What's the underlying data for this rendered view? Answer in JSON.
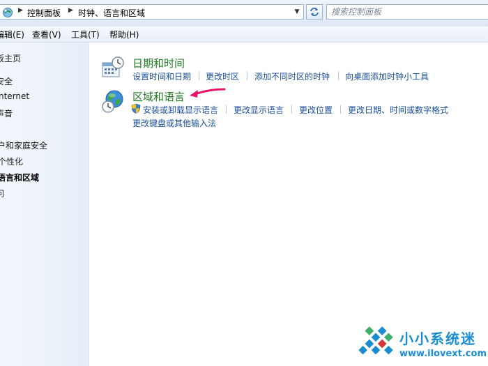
{
  "address_bar": {
    "breadcrumbs": [
      "控制面板",
      "时钟、语言和区域"
    ],
    "search_placeholder": "搜索控制面板"
  },
  "menu": {
    "items": [
      "编辑(E)",
      "查看(V)",
      "工具(T)",
      "帮助(H)"
    ]
  },
  "nav": {
    "items": [
      {
        "label": "板主页",
        "selected": false
      },
      {
        "label": "安全",
        "selected": false
      },
      {
        "label": "nternet",
        "selected": false
      },
      {
        "label": "声音",
        "selected": false
      },
      {
        "label": "户和家庭安全",
        "selected": false
      },
      {
        "label": "个性化",
        "selected": false
      },
      {
        "label": "语言和区域",
        "selected": true
      },
      {
        "label": "问",
        "selected": false
      }
    ]
  },
  "categories": [
    {
      "title": "日期和时间",
      "icon": "calendar-clock-icon",
      "tasks": [
        "设置时间和日期",
        "更改时区",
        "添加不同时区的时钟",
        "向桌面添加时钟小工具"
      ]
    },
    {
      "title": "区域和语言",
      "icon": "globe-clock-icon",
      "tasks": [
        "安装或卸载显示语言",
        "更改显示语言",
        "更改位置",
        "更改日期、时间或数字格式",
        "更改键盘或其他输入法"
      ],
      "first_task_icon": "uac-shield-icon"
    }
  ],
  "annotation": {
    "color": "#e8136b"
  },
  "watermark": {
    "title": "小小系统迷",
    "url": "www.ilovext.com"
  },
  "colors": {
    "category_title": "#1e7b1e",
    "link": "#1a4f9c",
    "watermark": "#1a8ccf"
  }
}
